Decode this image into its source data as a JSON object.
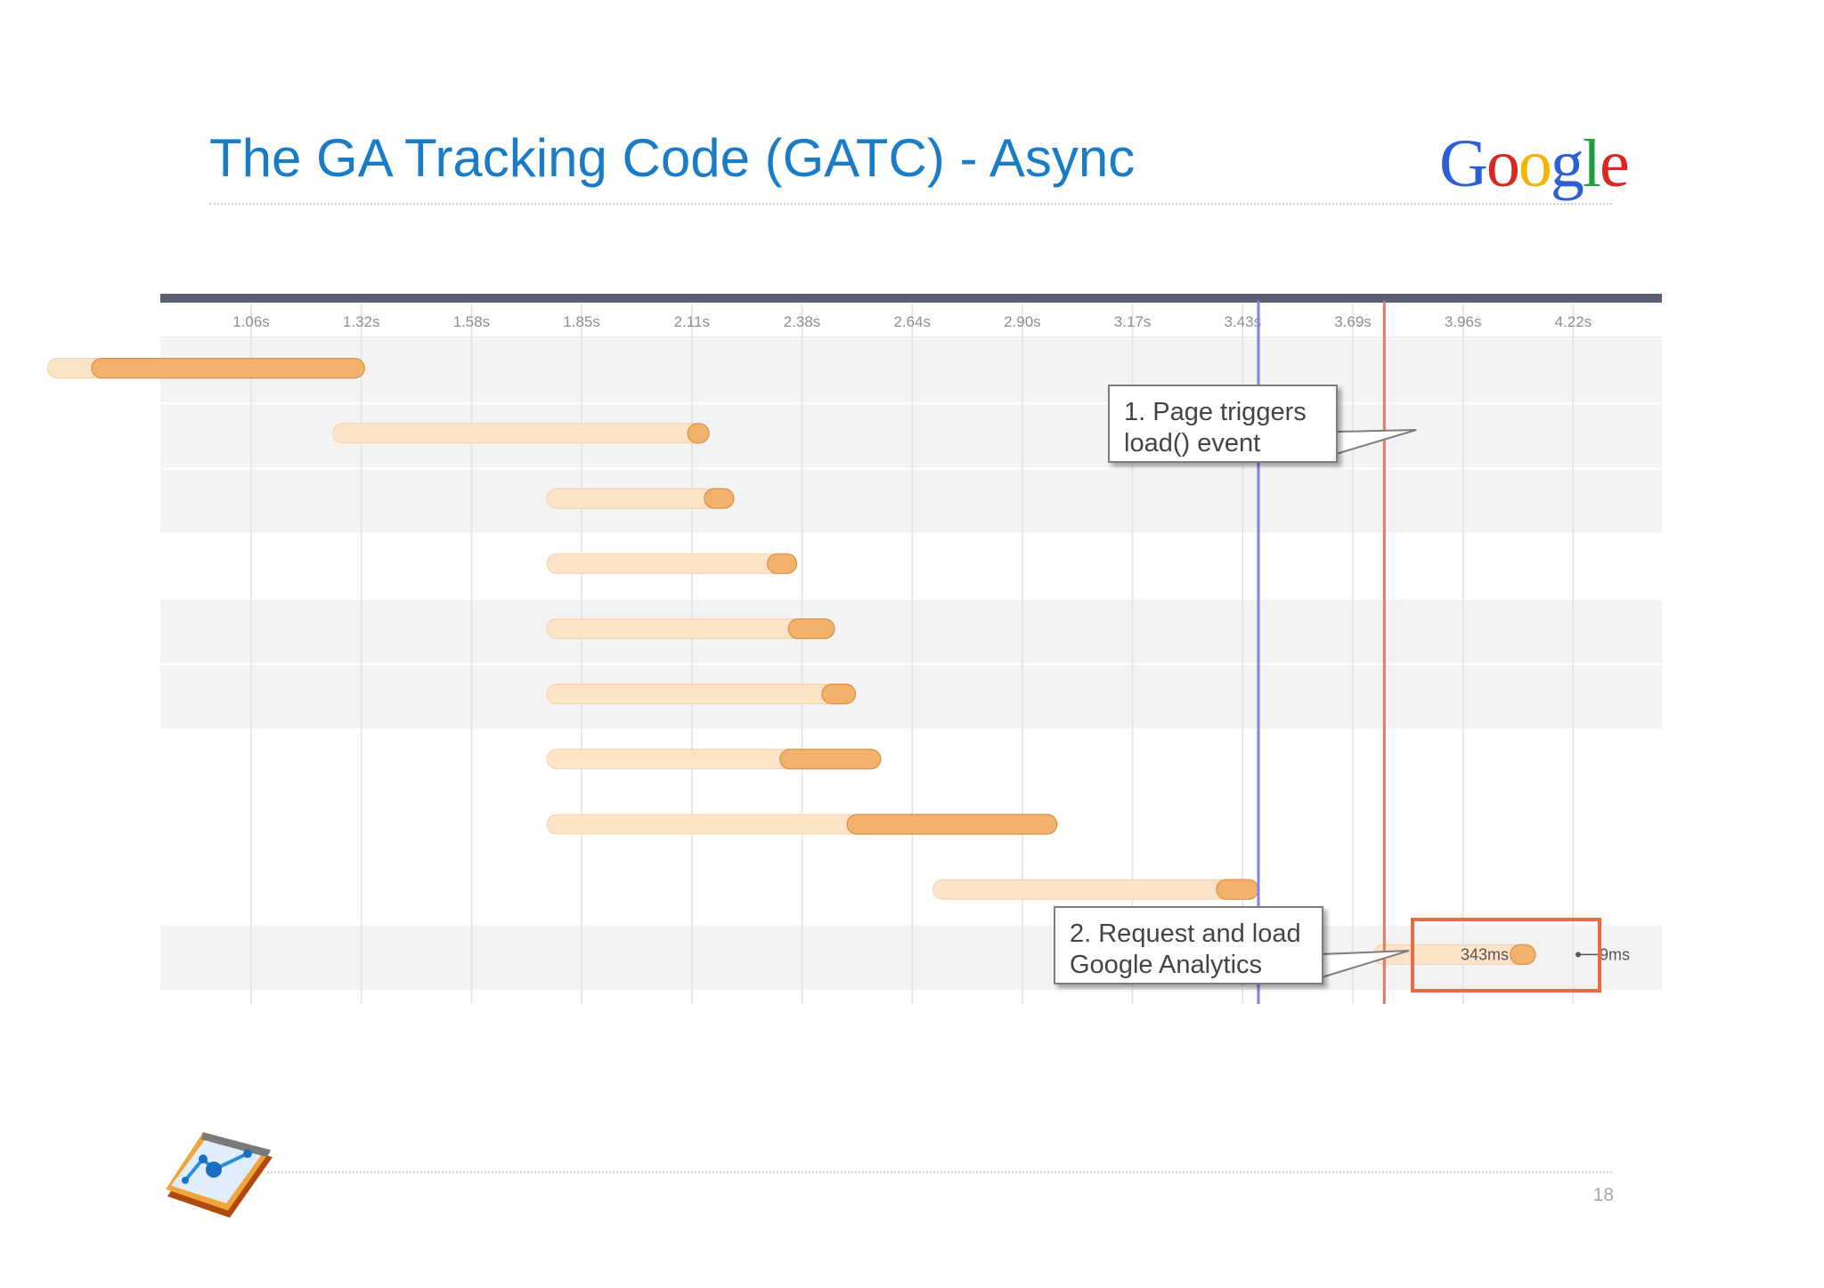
{
  "slide": {
    "title": "The GA Tracking Code (GATC) - Async",
    "page_number": "18"
  },
  "logo": {
    "letters": [
      {
        "ch": "G",
        "color": "#2a5fd6"
      },
      {
        "ch": "o",
        "color": "#d8281f"
      },
      {
        "ch": "o",
        "color": "#f4b400"
      },
      {
        "ch": "g",
        "color": "#2a5fd6"
      },
      {
        "ch": "l",
        "color": "#1e9e3c"
      },
      {
        "ch": "e",
        "color": "#d8281f"
      }
    ]
  },
  "timeline": {
    "ticks": [
      "1.06s",
      "1.32s",
      "1.58s",
      "1.85s",
      "2.11s",
      "2.38s",
      "2.64s",
      "2.90s",
      "3.17s",
      "3.43s",
      "3.69s",
      "3.96s",
      "4.22s"
    ],
    "rows": [
      {
        "wait_start": 0.6,
        "wait_end": 0.68,
        "recv_end": 1.33
      },
      {
        "wait_start": 1.28,
        "wait_end": 2.1,
        "recv_end": 2.14
      },
      {
        "wait_start": 1.79,
        "wait_end": 2.14,
        "recv_end": 2.21
      },
      {
        "wait_start": 1.79,
        "wait_end": 2.29,
        "recv_end": 2.36
      },
      {
        "wait_start": 1.79,
        "wait_end": 2.34,
        "recv_end": 2.45
      },
      {
        "wait_start": 1.79,
        "wait_end": 2.42,
        "recv_end": 2.5
      },
      {
        "wait_start": 1.79,
        "wait_end": 2.32,
        "recv_end": 2.56
      },
      {
        "wait_start": 1.79,
        "wait_end": 2.48,
        "recv_end": 2.98
      },
      {
        "wait_start": 2.71,
        "wait_end": 3.36,
        "recv_end": 3.46
      },
      {
        "wait_start": 3.76,
        "wait_end": 4.06,
        "recv_end": 4.12
      }
    ],
    "dom_content_loaded_s": 3.46,
    "load_event_s": 3.76,
    "ga_row": {
      "duration_label": "343ms",
      "tail_label": "9ms"
    },
    "colors": {
      "bar_wait": "#fde3c8",
      "bar_recv": "#f3b26b",
      "dom_line": "#8080ee",
      "load_line": "#ef7660",
      "highlight": "#ea6a43"
    }
  },
  "callouts": {
    "page_load": {
      "line1": "1. Page triggers",
      "line2": "load() event"
    },
    "ga_request": {
      "line1": "2. Request and load",
      "line2": "Google Analytics"
    }
  }
}
